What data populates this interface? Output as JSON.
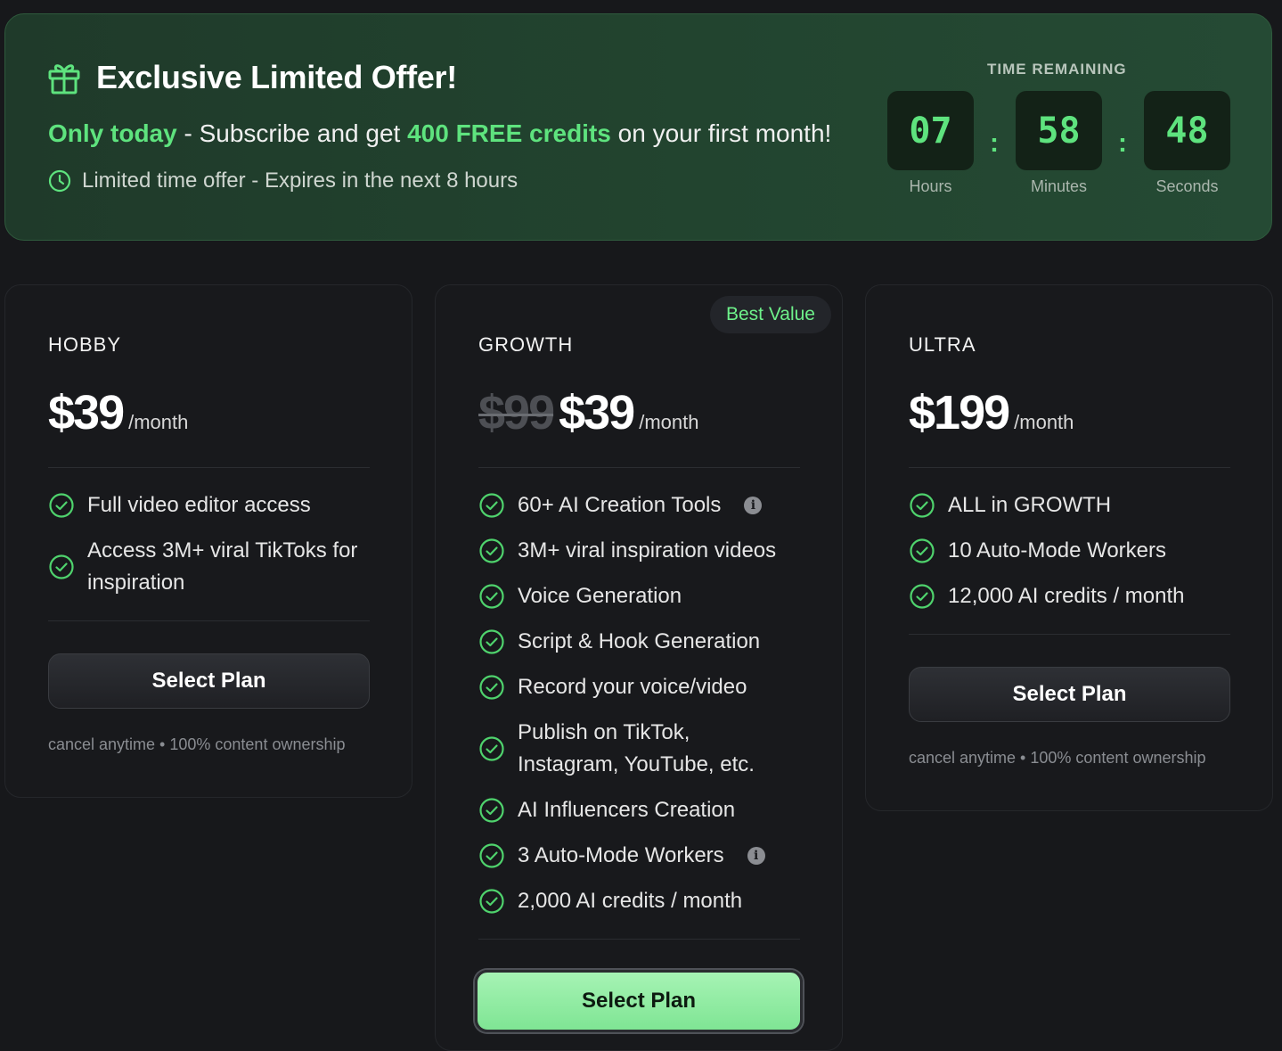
{
  "offer": {
    "title": "Exclusive Limited Offer!",
    "line_highlight_1": "Only today",
    "line_text_1": " - Subscribe and get ",
    "line_highlight_2": "400 FREE credits",
    "line_text_2": " on your first month!",
    "subtitle": "Limited time offer - Expires in the next 8 hours",
    "icons": {
      "title": "gift-icon",
      "subtitle": "clock-icon"
    },
    "accent_color": "#5ee37e"
  },
  "timer": {
    "label": "TIME REMAINING",
    "hours": "07",
    "minutes": "58",
    "seconds": "48",
    "hours_label": "Hours",
    "minutes_label": "Minutes",
    "seconds_label": "Seconds",
    "separator": ":"
  },
  "plans": [
    {
      "name": "HOBBY",
      "price": "$39",
      "period": "/month",
      "features": [
        "Full video editor access",
        "Access 3M+ viral TikToks for inspiration"
      ],
      "button": "Select Plan",
      "fine_print": "cancel anytime • 100% content ownership"
    },
    {
      "name": "GROWTH",
      "badge": "Best Value",
      "old_price": "$99",
      "price": "$39",
      "period": "/month",
      "features": [
        "60+ AI Creation Tools",
        "3M+ viral inspiration videos",
        "Voice Generation",
        "Script & Hook Generation",
        "Record your voice/video",
        "Publish on TikTok, Instagram, YouTube, etc.",
        "AI Influencers Creation",
        "3 Auto-Mode Workers",
        "2,000 AI credits / month"
      ],
      "info_marker": "i",
      "button": "Select Plan",
      "button_color": "#8ceb9f"
    },
    {
      "name": "ULTRA",
      "price": "$199",
      "period": "/month",
      "features": [
        "ALL in GROWTH",
        "10 Auto-Mode Workers",
        "12,000 AI credits / month"
      ],
      "button": "Select Plan",
      "fine_print": "cancel anytime • 100% content ownership"
    }
  ]
}
